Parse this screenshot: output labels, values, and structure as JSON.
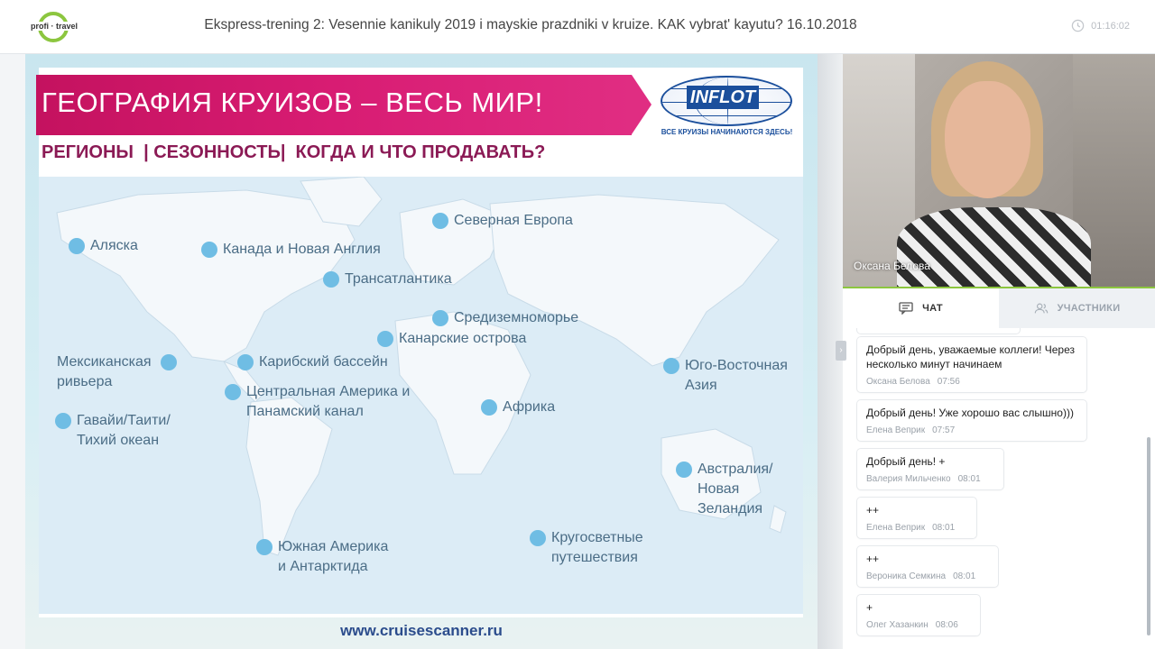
{
  "header": {
    "logo_text": "profi · travel",
    "title": "Ekspress-trening 2: Vesennie kanikuly 2019 i mayskie prazdniki v kruize. KAK vybrat' kayutu? 16.10.2018",
    "timer": "01:16:02",
    "timer_icon": "clock-icon"
  },
  "slide": {
    "banner_title": "ГЕОГРАФИЯ КРУИЗОВ – ВЕСЬ МИР!",
    "subtitle": "РЕГИОНЫ  | СЕЗОННОСТЬ|  КОГДА И ЧТО ПРОДАВАТЬ?",
    "brand_logo": "INFLOT",
    "brand_tagline": "ВСЕ КРУИЗЫ НАЧИНАЮТСЯ ЗДЕСЬ!",
    "url": "www.cruisescanner.ru",
    "accent_color": "#d81c73",
    "pin_color": "#6fbde4",
    "regions": [
      {
        "id": "alaska",
        "label": "Аляска"
      },
      {
        "id": "canada",
        "label": "Канада и Новая Англия"
      },
      {
        "id": "north-europe",
        "label": "Северная Европа"
      },
      {
        "id": "transatlantic",
        "label": "Трансатлантика"
      },
      {
        "id": "mediterranean",
        "label": "Средиземноморье"
      },
      {
        "id": "canary",
        "label": "Канарские острова"
      },
      {
        "id": "mexican-riviera",
        "label": "Мексиканская\nривьера"
      },
      {
        "id": "caribbean",
        "label": "Карибский бассейн"
      },
      {
        "id": "central-america",
        "label": "Центральная Америка и\nПанамский канал"
      },
      {
        "id": "se-asia",
        "label": "Юго-Восточная\nАзия"
      },
      {
        "id": "hawaii",
        "label": "Гавайи/Таити/\nТихий океан"
      },
      {
        "id": "africa",
        "label": "Африка"
      },
      {
        "id": "australia",
        "label": "Австралия/\nНовая\nЗеландия"
      },
      {
        "id": "south-america",
        "label": "Южная Америка\nи Антарктида"
      },
      {
        "id": "world",
        "label": "Кругосветные\nпутешествия"
      }
    ]
  },
  "camera": {
    "participant_name": "Оксана Белова"
  },
  "tabs": {
    "chat_label": "ЧАТ",
    "chat_icon": "chat-icon",
    "participants_label": "УЧАСТНИКИ",
    "participants_icon": "users-icon"
  },
  "chat": {
    "messages": [
      {
        "text": "Добрый день, уважаемые коллеги! Через\nнесколько минут начинаем",
        "author": "Оксана Белова",
        "time": "07:56"
      },
      {
        "text": "Добрый день! Уже хорошо вас слышно)))",
        "author": "Елена Веприк",
        "time": "07:57"
      },
      {
        "text": "Добрый день! +",
        "author": "Валерия Мильченко",
        "time": "08:01"
      },
      {
        "text": "++",
        "author": "Елена Веприк",
        "time": "08:01"
      },
      {
        "text": "++",
        "author": "Вероника Семкина",
        "time": "08:01"
      },
      {
        "text": "+",
        "author": "Олег Хазанкин",
        "time": "08:06"
      }
    ]
  }
}
